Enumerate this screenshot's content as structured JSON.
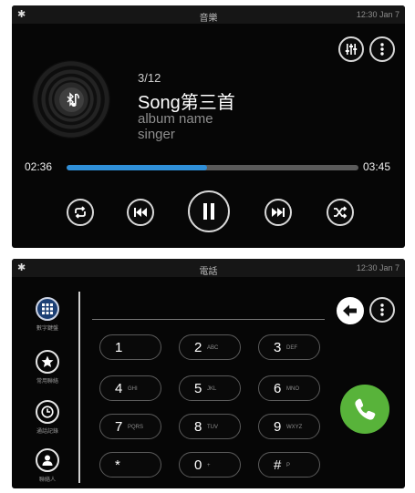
{
  "music": {
    "status": {
      "title": "音樂",
      "time": "12:30",
      "date": "Jan 7"
    },
    "track_no": "3/12",
    "song": "Song第三首",
    "album": "album name",
    "singer": "singer",
    "time_current": "02:36",
    "time_total": "03:45",
    "progress": 0.48
  },
  "phone": {
    "status": {
      "title": "電話",
      "time": "12:30",
      "date": "Jan 7"
    },
    "sidebar": [
      {
        "label": "數字鍵盤",
        "icon": "keypad-icon"
      },
      {
        "label": "常用聯絡",
        "icon": "star-icon"
      },
      {
        "label": "通話記錄",
        "icon": "clock-icon"
      },
      {
        "label": "聯絡人",
        "icon": "contact-icon"
      }
    ],
    "keys": [
      {
        "digit": "1",
        "letters": ""
      },
      {
        "digit": "2",
        "letters": "ABC"
      },
      {
        "digit": "3",
        "letters": "DEF"
      },
      {
        "digit": "4",
        "letters": "GHI"
      },
      {
        "digit": "5",
        "letters": "JKL"
      },
      {
        "digit": "6",
        "letters": "MNO"
      },
      {
        "digit": "7",
        "letters": "PQRS"
      },
      {
        "digit": "8",
        "letters": "TUV"
      },
      {
        "digit": "9",
        "letters": "WXYZ"
      },
      {
        "digit": "*",
        "letters": ""
      },
      {
        "digit": "0",
        "letters": "+"
      },
      {
        "digit": "#",
        "letters": "P"
      }
    ],
    "call_color": "#58b33a"
  }
}
